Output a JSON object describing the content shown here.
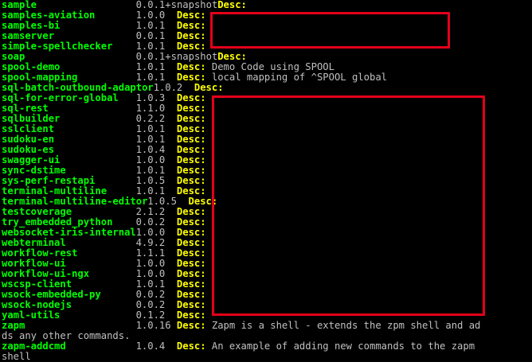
{
  "terminal": {
    "rows": [
      {
        "name": "sample",
        "version": "0.0.1+snapshot",
        "desc_label": "Desc:",
        "description": ""
      },
      {
        "name": "samples-aviation",
        "version": "1.0.0",
        "desc_label": "Desc:",
        "description": ""
      },
      {
        "name": "samples-bi",
        "version": "1.0.1",
        "desc_label": "Desc:",
        "description": ""
      },
      {
        "name": "samserver",
        "version": "0.0.1",
        "desc_label": "Desc:",
        "description": ""
      },
      {
        "name": "simple-spellchecker",
        "version": "1.0.1",
        "desc_label": "Desc:",
        "description": ""
      },
      {
        "name": "soap",
        "version": "0.0.1+snapshot",
        "desc_label": "Desc:",
        "description": ""
      },
      {
        "name": "spool-demo",
        "version": "1.0.1",
        "desc_label": "Desc:",
        "description": "Demo Code using SPOOL"
      },
      {
        "name": "spool-mapping",
        "version": "1.0.1",
        "desc_label": "Desc:",
        "description": "local mapping of ^SPOOL global"
      },
      {
        "name": "sql-batch-outbound-adaptor",
        "version": "1.0.2",
        "desc_label": "Desc:",
        "description": ""
      },
      {
        "name": "sql-for-error-global",
        "version": "1.0.3",
        "desc_label": "Desc:",
        "description": ""
      },
      {
        "name": "sql-rest",
        "version": "1.1.0",
        "desc_label": "Desc:",
        "description": ""
      },
      {
        "name": "sqlbuilder",
        "version": "0.2.2",
        "desc_label": "Desc:",
        "description": ""
      },
      {
        "name": "sslclient",
        "version": "1.0.1",
        "desc_label": "Desc:",
        "description": ""
      },
      {
        "name": "sudoku-en",
        "version": "1.0.1",
        "desc_label": "Desc:",
        "description": ""
      },
      {
        "name": "sudoku-es",
        "version": "1.0.4",
        "desc_label": "Desc:",
        "description": ""
      },
      {
        "name": "swagger-ui",
        "version": "1.0.0",
        "desc_label": "Desc:",
        "description": ""
      },
      {
        "name": "sync-dstime",
        "version": "1.0.1",
        "desc_label": "Desc:",
        "description": ""
      },
      {
        "name": "sys-perf-restapi",
        "version": "1.0.5",
        "desc_label": "Desc:",
        "description": ""
      },
      {
        "name": "terminal-multiline",
        "version": "1.0.1",
        "desc_label": "Desc:",
        "description": ""
      },
      {
        "name": "terminal-multiline-editor",
        "version": "1.0.5",
        "desc_label": "Desc:",
        "description": ""
      },
      {
        "name": "testcoverage",
        "version": "2.1.2",
        "desc_label": "Desc:",
        "description": ""
      },
      {
        "name": "try_embedded_python",
        "version": "0.0.2",
        "desc_label": "Desc:",
        "description": ""
      },
      {
        "name": "websocket-iris-internal",
        "version": "1.0.0",
        "desc_label": "Desc:",
        "description": ""
      },
      {
        "name": "webterminal",
        "version": "4.9.2",
        "desc_label": "Desc:",
        "description": ""
      },
      {
        "name": "workflow-rest",
        "version": "1.1.1",
        "desc_label": "Desc:",
        "description": ""
      },
      {
        "name": "workflow-ui",
        "version": "1.0.0",
        "desc_label": "Desc:",
        "description": ""
      },
      {
        "name": "workflow-ui-ngx",
        "version": "1.0.0",
        "desc_label": "Desc:",
        "description": ""
      },
      {
        "name": "wscsp-client",
        "version": "1.0.1",
        "desc_label": "Desc:",
        "description": ""
      },
      {
        "name": "wsock-embedded-py",
        "version": "0.0.2",
        "desc_label": "Desc:",
        "description": ""
      },
      {
        "name": "wsock-nodejs",
        "version": "0.0.2",
        "desc_label": "Desc:",
        "description": ""
      },
      {
        "name": "yaml-utils",
        "version": "0.1.2",
        "desc_label": "Desc:",
        "description": ""
      },
      {
        "name": "zapm",
        "version": "1.0.16",
        "desc_label": "Desc:",
        "description": "Zapm is a shell - extends the zpm shell and ad"
      },
      {
        "name": "",
        "version": "",
        "desc_label": "",
        "description": "",
        "continuation": "ds any other commands."
      },
      {
        "name": "zapm-addcmd",
        "version": "1.0.4",
        "desc_label": "Desc:",
        "description": "An example of adding new commands to the zapm"
      },
      {
        "name": "",
        "version": "",
        "desc_label": "",
        "description": "",
        "continuation": "shell"
      }
    ]
  },
  "colors": {
    "background": "#000000",
    "package_name": "#00ff00",
    "desc_label": "#ffff00",
    "text": "#c0c0c0",
    "redaction_border": "#e3001b"
  }
}
